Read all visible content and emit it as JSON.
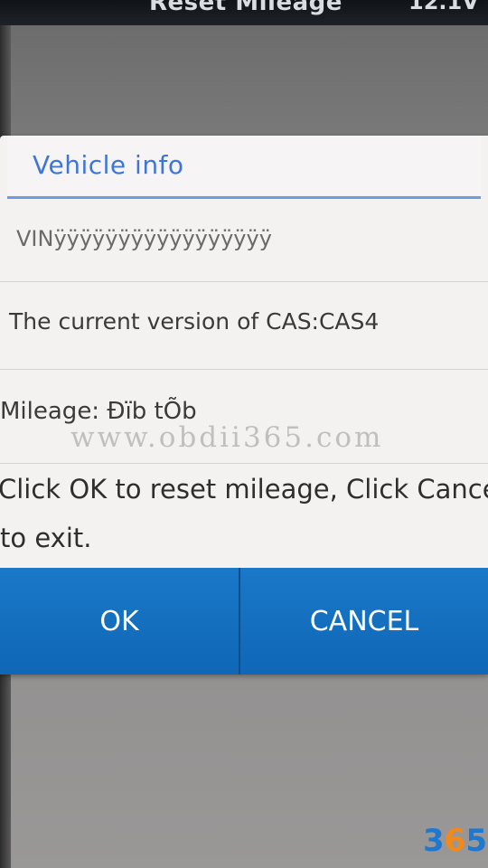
{
  "header": {
    "title": "Reset Mileage",
    "voltage": "12.1V"
  },
  "dialog": {
    "title": "Vehicle info",
    "vin": "VINÿÿÿÿÿÿÿÿÿÿÿÿÿÿÿÿÿ",
    "cas_version": "The current version of CAS:CAS4",
    "mileage": "Mileage: Đïb tÕb",
    "message_line1": "Click OK to reset mileage, Click Cance",
    "message_line2": "to exit."
  },
  "buttons": {
    "ok_label": "OK",
    "cancel_label": "CANCEL"
  },
  "watermark": "www.obdii365.com",
  "logo": {
    "left": "3",
    "middle": "6",
    "right": "5"
  },
  "colors": {
    "accent": "#3f76d6",
    "button": "#1a78c8",
    "logo_blue": "#1e78cf",
    "logo_orange": "#f08a1c"
  }
}
